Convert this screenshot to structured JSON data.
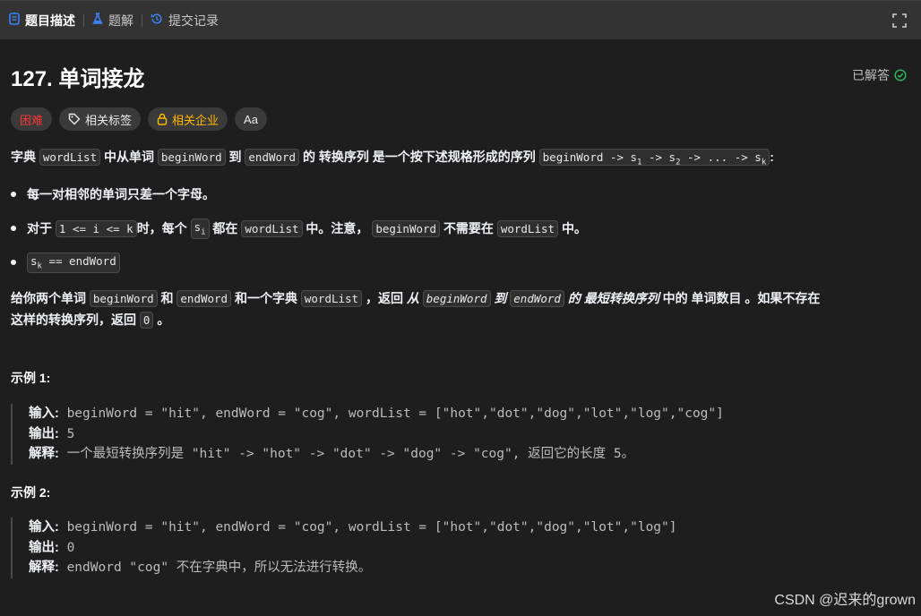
{
  "tabs": [
    {
      "label": "题目描述",
      "icon": "document-icon",
      "active": true
    },
    {
      "label": "题解",
      "icon": "flask-icon",
      "active": false
    },
    {
      "label": "提交记录",
      "icon": "history-icon",
      "active": false
    }
  ],
  "problem": {
    "title": "127. 单词接龙",
    "status": "已解答",
    "status_color": "#2cbb5d"
  },
  "tags": {
    "difficulty": "困难",
    "related_tags": "相关标签",
    "related_companies": "相关企业",
    "translate": "Aa"
  },
  "description": {
    "p1_a": "字典",
    "p1_code1": "wordList",
    "p1_b": "中从单词",
    "p1_code2": "beginWord",
    "p1_c": "到",
    "p1_code3": "endWord",
    "p1_d": "的",
    "p1_bold": "转换序列",
    "p1_e": "是一个按下述规格形成的序列",
    "p1_code4": "beginWord -> s",
    "p1_code4_sub1": "1",
    "p1_code4_mid1": " -> s",
    "p1_code4_sub2": "2",
    "p1_code4_mid2": " -> ... -> s",
    "p1_code4_sub3": "k",
    "p1_end": ":",
    "bullet1": "每一对相邻的单词只差一个字母。",
    "bullet2_a": "对于",
    "bullet2_code1": "1 <= i <= k",
    "bullet2_b": "时，每个",
    "bullet2_code2": "s",
    "bullet2_code2_sub": "i",
    "bullet2_c": "都在",
    "bullet2_code3": "wordList",
    "bullet2_d": "中。注意，",
    "bullet2_code4": "beginWord",
    "bullet2_e": "不需要在",
    "bullet2_code5": "wordList",
    "bullet2_f": "中。",
    "bullet3_code": "s",
    "bullet3_sub": "k",
    "bullet3_rest": " == endWord",
    "p2_a": "给你两个单词",
    "p2_code1": "beginWord",
    "p2_b": "和",
    "p2_code2": "endWord",
    "p2_c": "和一个字典",
    "p2_code3": "wordList",
    "p2_d": "，返回",
    "p2_e": "从",
    "p2_code4": "beginWord",
    "p2_f": "到",
    "p2_code5": "endWord",
    "p2_g": "的",
    "p2_h": "最短转换序列",
    "p2_i": "中的",
    "p2_j": "单词数目",
    "p2_k": "。如果不存在",
    "p2_line2": "这样的转换序列，返回",
    "p2_code6": "0",
    "p2_end": "。"
  },
  "examples": [
    {
      "title": "示例 1:",
      "input_label": "输入:",
      "input": "beginWord = \"hit\", endWord = \"cog\", wordList = [\"hot\",\"dot\",\"dog\",\"lot\",\"log\",\"cog\"]",
      "output_label": "输出:",
      "output": "5",
      "explain_label": "解释:",
      "explain": "一个最短转换序列是 \"hit\" -> \"hot\" -> \"dot\" -> \"dog\" -> \"cog\", 返回它的长度 5。"
    },
    {
      "title": "示例 2:",
      "input_label": "输入:",
      "input": "beginWord = \"hit\", endWord = \"cog\", wordList = [\"hot\",\"dot\",\"dog\",\"lot\",\"log\"]",
      "output_label": "输出:",
      "output": "0",
      "explain_label": "解释:",
      "explain": "endWord \"cog\" 不在字典中，所以无法进行转换。"
    }
  ],
  "watermark": "CSDN @迟来的grown"
}
